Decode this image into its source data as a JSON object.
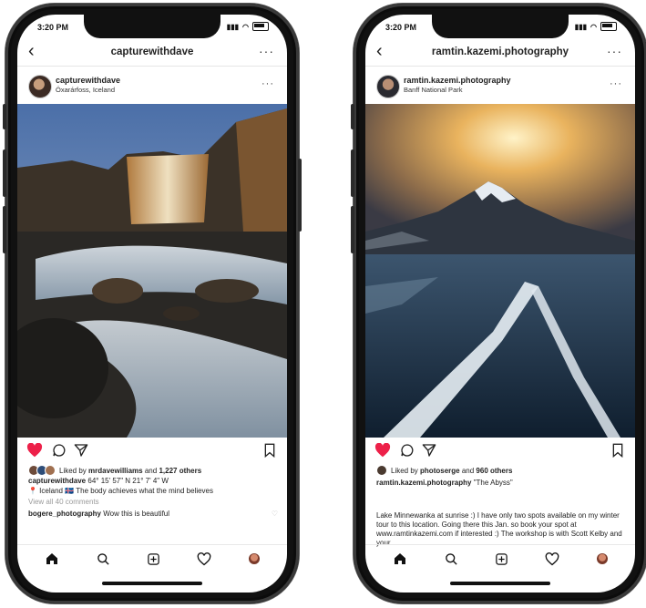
{
  "phones": [
    {
      "time": "3:20 PM",
      "nav_title": "capturewithdave",
      "username": "capturewithdave",
      "location": "Öxarárfoss, Iceland",
      "liked_by_prefix": "Liked by",
      "liked_by_user": "mrdavewilliams",
      "liked_by_and": "and",
      "liked_by_others": "1,227 others",
      "caption_user": "capturewithdave",
      "caption_text": "64° 15' 57\" N 21° 7' 4\" W",
      "caption_line2": "📍 Iceland 🇮🇸 The body achieves what the mind believes",
      "view_comments": "View all 40 comments",
      "comment_user": "bogere_photography",
      "comment_text": "Wow this is beautiful"
    },
    {
      "time": "3:20 PM",
      "nav_title": "ramtin.kazemi.photography",
      "username": "ramtin.kazemi.photography",
      "location": "Banff National Park",
      "liked_by_prefix": "Liked by",
      "liked_by_user": "photoserge",
      "liked_by_and": "and",
      "liked_by_others": "960 others",
      "caption_user": "ramtin.kazemi.photography",
      "caption_text": "\"The Abyss\"",
      "long_caption": "Lake Minnewanka at sunrise :) I have only two spots available on my winter tour to this location. Going there this Jan. so book your spot at www.ramtinkazemi.com if interested :) The workshop is with Scott Kelby and your"
    }
  ],
  "colors": {
    "heart": "#ed2049",
    "text": "#222222",
    "muted": "#9a9a9a"
  },
  "icons": [
    "back-arrow-icon",
    "more-icon",
    "heart-icon",
    "comment-icon",
    "share-icon",
    "bookmark-icon",
    "home-icon",
    "search-icon",
    "add-post-icon",
    "activity-icon",
    "profile-avatar"
  ]
}
